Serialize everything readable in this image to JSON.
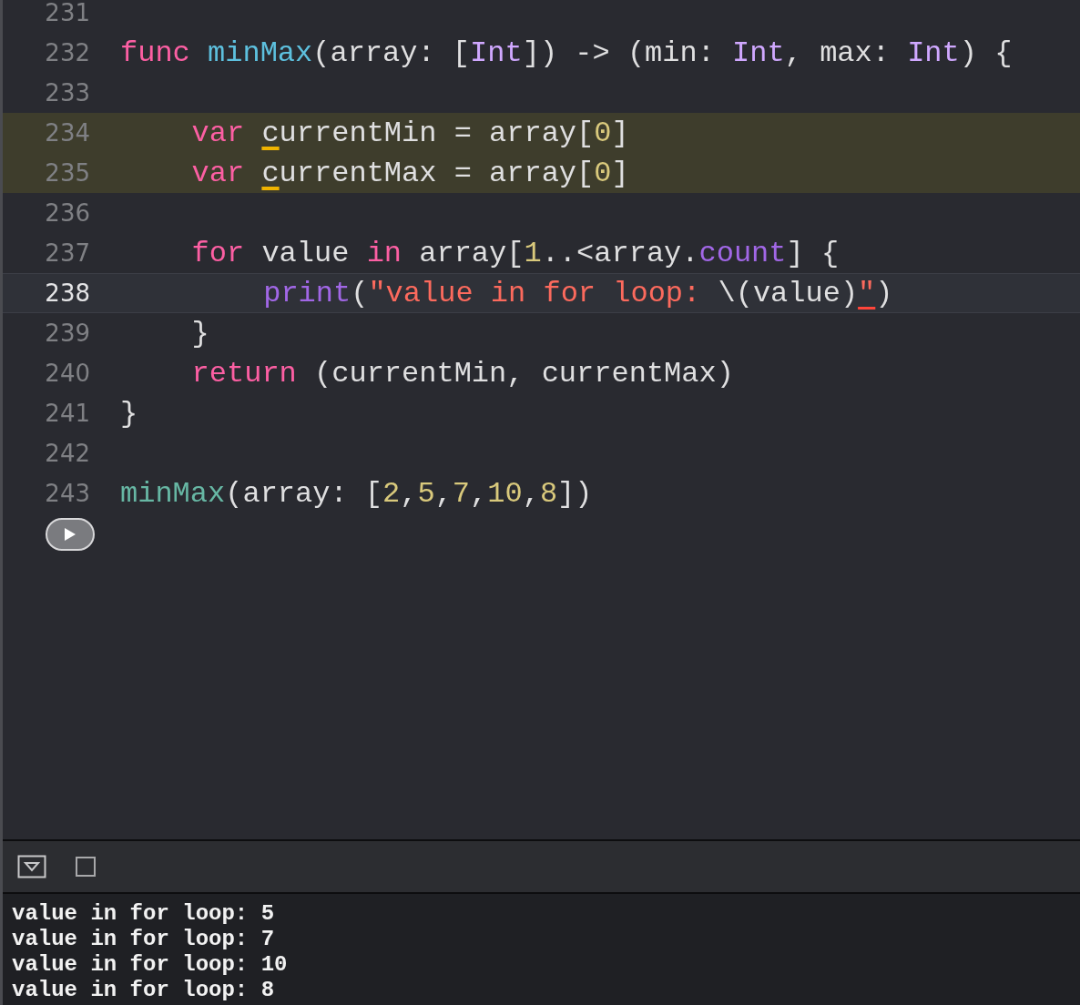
{
  "editor": {
    "lines": [
      {
        "number": "231",
        "warning": false,
        "current": false
      },
      {
        "number": "232",
        "warning": false,
        "current": false,
        "tokens": [
          {
            "kind": "keyword",
            "text": "func"
          },
          {
            "kind": "declaration",
            "text": "minMax"
          },
          {
            "kind": "plain",
            "text": "(array: ["
          },
          {
            "kind": "type",
            "text": "Int"
          },
          {
            "kind": "plain",
            "text": "]) -> (min:"
          },
          {
            "kind": "type",
            "text": "Int"
          },
          {
            "kind": "plain",
            "text": ", max:"
          },
          {
            "kind": "type",
            "text": "Int"
          },
          {
            "kind": "plain",
            "text": ") {"
          }
        ],
        "children": [
          {
            "number": "233",
            "warning": false,
            "current": false
          },
          {
            "number": "234",
            "warning": true,
            "current": false,
            "tokens": [
              {
                "kind": "keyword",
                "text": "var"
              },
              {
                "kind": "flagged",
                "text": "c"
              },
              {
                "kind": "plain",
                "text": "urrentMin = array["
              },
              {
                "kind": "number",
                "text": "0"
              },
              {
                "kind": "plain",
                "text": "]"
              }
            ]
          },
          {
            "number": "235",
            "warning": true,
            "current": false,
            "tokens": [
              {
                "kind": "keyword",
                "text": "var"
              },
              {
                "kind": "flagged",
                "text": "c"
              },
              {
                "kind": "plain",
                "text": "urrentMax = array["
              },
              {
                "kind": "number",
                "text": "0"
              },
              {
                "kind": "plain",
                "text": "]"
              }
            ]
          },
          {
            "number": "236",
            "warning": false,
            "current": false
          },
          {
            "number": "237",
            "warning": false,
            "current": false,
            "tokens": [
              {
                "kind": "keyword",
                "text": "for"
              },
              {
                "kind": "plain",
                "text": "value"
              },
              {
                "kind": "keyword",
                "text": "in"
              },
              {
                "kind": "plain",
                "text": "array["
              },
              {
                "kind": "number",
                "text": "1"
              },
              {
                "kind": "plain",
                "text": "..<array."
              },
              {
                "kind": "method",
                "text": "count"
              },
              {
                "kind": "plain",
                "text": "] {"
              }
            ],
            "children": [
              {
                "number": "238",
                "warning": false,
                "current": true,
                "tokens": [
                  {
                    "kind": "method",
                    "text": "print"
                  },
                  {
                    "kind": "plain",
                    "text": "("
                  },
                  {
                    "kind": "string",
                    "text": "\"value in for loop:"
                  },
                  {
                    "kind": "plain",
                    "text": "\\(value)"
                  },
                  {
                    "kind": "error_string",
                    "text": "\""
                  },
                  {
                    "kind": "plain",
                    "text": ")"
                  }
                ]
              }
            ]
          },
          {
            "number": "239",
            "warning": false,
            "current": false,
            "tokens": [
              {
                "kind": "plain",
                "text": "}"
              }
            ]
          },
          {
            "number": "240",
            "warning": false,
            "current": false,
            "tokens": [
              {
                "kind": "keyword",
                "text": "return"
              },
              {
                "kind": "plain",
                "text": "(currentMin, currentMax)"
              }
            ]
          }
        ]
      },
      {
        "number": "241",
        "warning": false,
        "current": false,
        "tokens": [
          {
            "kind": "plain",
            "text": "}"
          }
        ]
      },
      {
        "number": "242",
        "warning": false,
        "current": false
      },
      {
        "number": "243",
        "warning": false,
        "current": false,
        "tokens": [
          {
            "kind": "call",
            "text": "minMax"
          },
          {
            "kind": "plain",
            "text": "(array: ["
          },
          {
            "kind": "number",
            "text": "2"
          },
          {
            "kind": "plain",
            "text": ","
          },
          {
            "kind": "number",
            "text": "5"
          },
          {
            "kind": "plain",
            "text": ","
          },
          {
            "kind": "number",
            "text": "7"
          },
          {
            "kind": "plain",
            "text": ","
          },
          {
            "kind": "number",
            "text": "10"
          },
          {
            "kind": "plain",
            "text": ","
          },
          {
            "kind": "number",
            "text": "8"
          },
          {
            "kind": "plain",
            "text": "])"
          }
        ]
      }
    ]
  },
  "console": {
    "lines": [
      "value in for loop: 5",
      "value in for loop: 7",
      "value in for loop: 10",
      "value in for loop: 8"
    ]
  }
}
